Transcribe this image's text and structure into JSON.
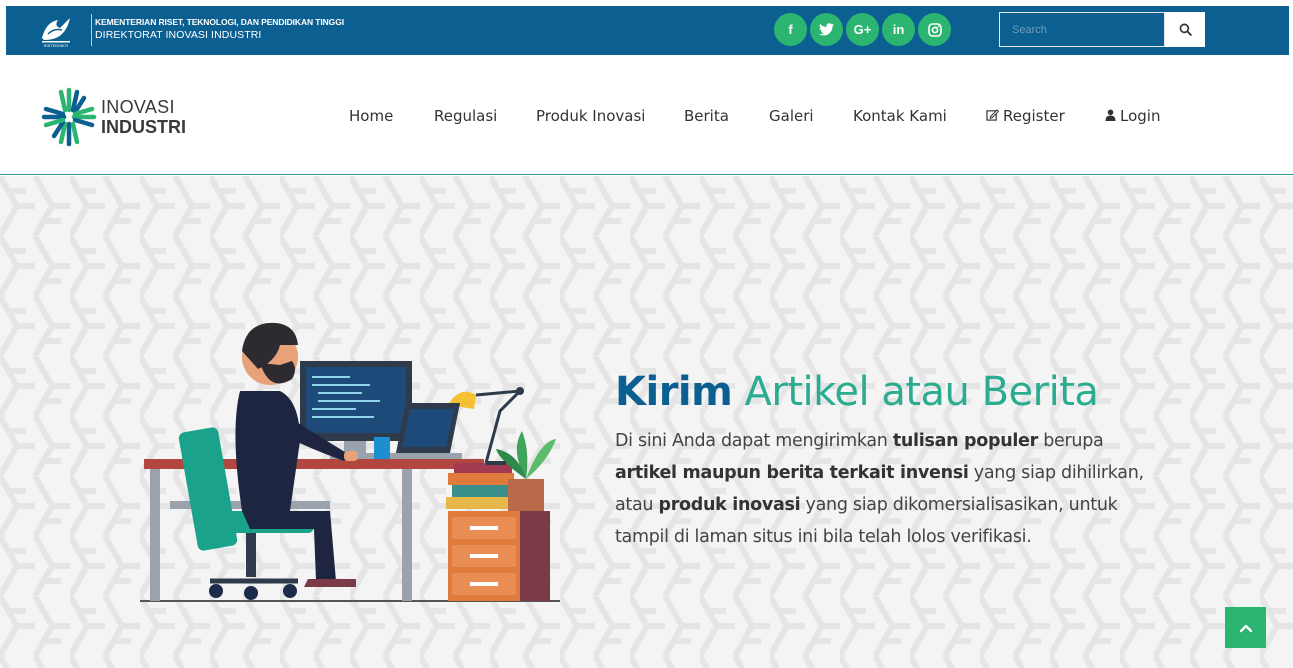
{
  "topbar": {
    "ministry_line1": "KEMENTERIAN RISET, TEKNOLOGI, DAN PENDIDIKAN TINGGI",
    "ministry_line2": "DIREKTORAT INOVASI INDUSTRI",
    "logo_caption": "RISTEKDIKTI",
    "social": [
      {
        "label": "f",
        "icon": "facebook-icon"
      },
      {
        "label": "✉",
        "icon": "twitter-icon"
      },
      {
        "label": "G+",
        "icon": "google-plus-icon"
      },
      {
        "label": "in",
        "icon": "linkedin-icon"
      },
      {
        "label": "◎",
        "icon": "instagram-icon"
      }
    ],
    "search_placeholder": "Search",
    "search_icon": "search-icon"
  },
  "brand": {
    "line1": "INOVASI",
    "line2": "INDUSTRI"
  },
  "nav": {
    "items": [
      {
        "label": "Home"
      },
      {
        "label": "Regulasi"
      },
      {
        "label": "Produk Inovasi"
      },
      {
        "label": "Berita"
      },
      {
        "label": "Galeri"
      },
      {
        "label": "Kontak Kami"
      },
      {
        "label": "Register",
        "icon": "edit-icon"
      },
      {
        "label": "Login",
        "icon": "user-icon"
      }
    ]
  },
  "hero": {
    "title_bold": "Kirim",
    "title_rest": "Artikel atau Berita",
    "desc": [
      {
        "t": "Di sini Anda dapat mengirimkan ",
        "b": false
      },
      {
        "t": "tulisan populer",
        "b": true
      },
      {
        "t": " berupa ",
        "b": false
      },
      {
        "t": "artikel maupun berita terkait invensi",
        "b": true
      },
      {
        "t": " yang siap dihilirkan, atau ",
        "b": false
      },
      {
        "t": "produk inovasi",
        "b": true
      },
      {
        "t": " yang siap dikomersialisasikan, untuk tampil di laman situs ini bila telah lolos verifikasi.",
        "b": false
      }
    ]
  },
  "colors": {
    "topbar": "#0b5f91",
    "accent_green": "#2bb571",
    "teal": "#2bac90",
    "navy": "#0b5f91"
  },
  "scroll_top_icon": "chevron-up-icon"
}
